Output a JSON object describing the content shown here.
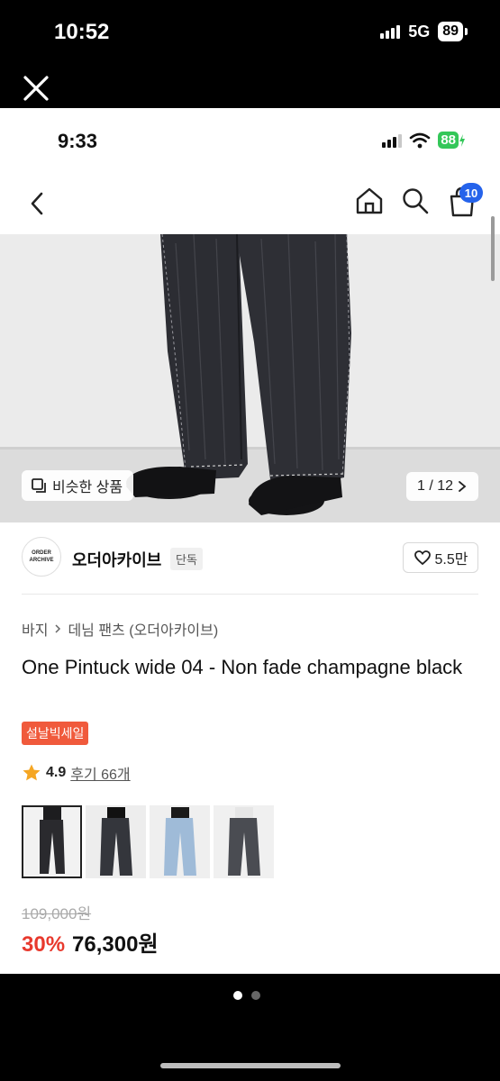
{
  "outer_status": {
    "time": "10:52",
    "network": "5G",
    "battery": "89"
  },
  "inner_status": {
    "time": "9:33",
    "battery": "88"
  },
  "nav": {
    "cart_count": "10"
  },
  "hero": {
    "similar_label": "비슷한 상품",
    "counter": "1 / 12"
  },
  "brand": {
    "logo_text": "ORDER ARCHIVE",
    "name": "오더아카이브",
    "tag": "단독",
    "likes": "5.5만"
  },
  "breadcrumb": [
    "바지",
    "데님 팬츠 (오더아카이브)"
  ],
  "product": {
    "title": "One Pintuck wide 04 - Non fade champagne black",
    "sale_badge": "설날빅세일",
    "rating": "4.9",
    "reviews": "후기 66개",
    "original_price": "109,000원",
    "discount": "30%",
    "price": "76,300원"
  },
  "colors": {
    "accent_blue": "#2563eb",
    "sale_red": "#e8392d",
    "badge_orange": "#f05a3c",
    "star": "#f5a623",
    "battery_green": "#34c759"
  },
  "icons": [
    "close-icon",
    "back-icon",
    "home-icon",
    "search-icon",
    "cart-icon",
    "similar-icon",
    "chevron-right-icon",
    "heart-icon",
    "star-icon"
  ]
}
